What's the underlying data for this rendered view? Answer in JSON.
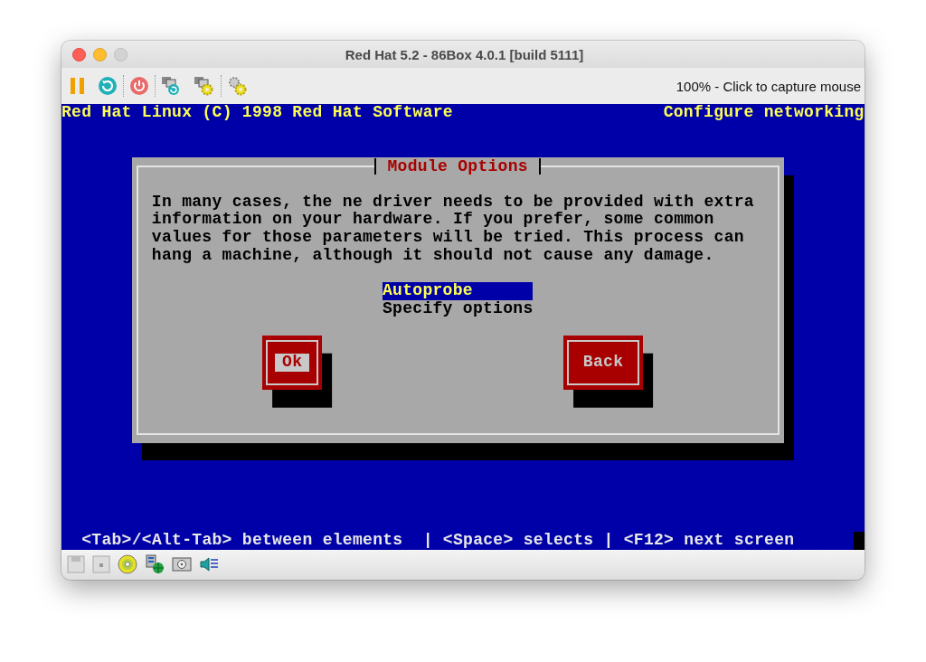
{
  "window": {
    "title": "Red Hat 5.2 - 86Box 4.0.1 [build 5111]"
  },
  "toolbar": {
    "status": "100% - Click to capture mouse"
  },
  "screen": {
    "header_left": "Red Hat Linux (C) 1998 Red Hat Software",
    "header_right": "Configure networking",
    "dialog": {
      "title": "Module Options",
      "message": "In many cases, the ne driver needs to be provided with extra information on your hardware. If you prefer, some common values for those parameters will be tried. This process can hang a machine, although it should not cause any damage.",
      "options": [
        {
          "label": "Autoprobe",
          "selected": true
        },
        {
          "label": "Specify options",
          "selected": false
        }
      ],
      "buttons": [
        {
          "label": "Ok",
          "focused": true
        },
        {
          "label": "Back",
          "focused": false
        }
      ]
    },
    "help_line": "<Tab>/<Alt-Tab> between elements  | <Space> selects | <F12> next screen"
  }
}
